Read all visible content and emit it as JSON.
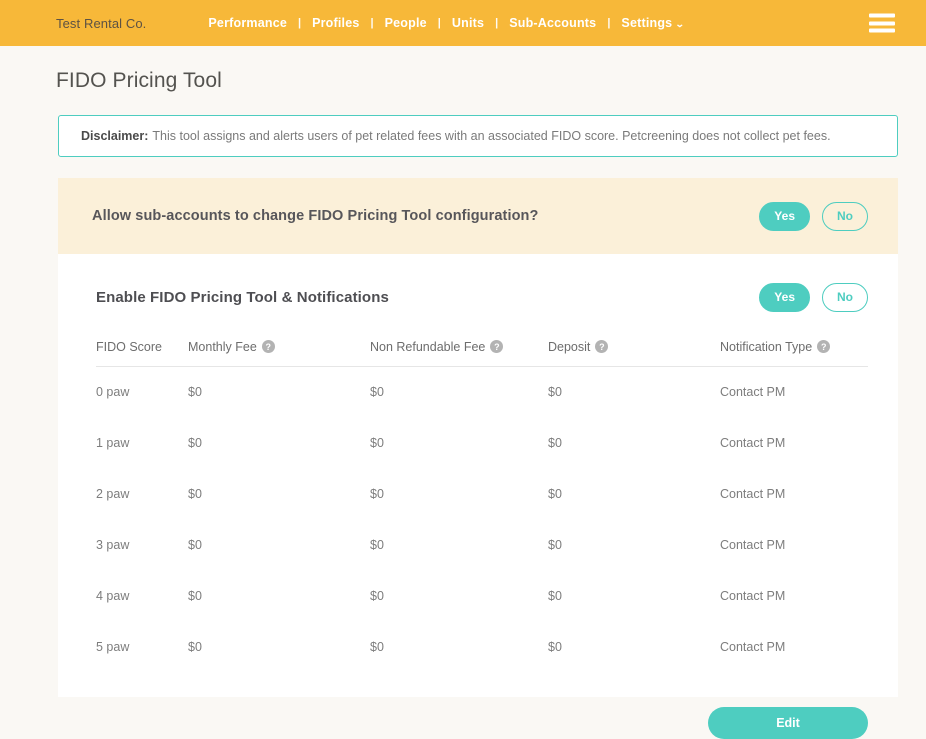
{
  "nav": {
    "brand": "Test Rental Co.",
    "separator": "|",
    "links": [
      {
        "label": "Performance",
        "has_caret": false
      },
      {
        "label": "Profiles",
        "has_caret": false
      },
      {
        "label": "People",
        "has_caret": false
      },
      {
        "label": "Units",
        "has_caret": false
      },
      {
        "label": "Sub-Accounts",
        "has_caret": false
      },
      {
        "label": "Settings",
        "has_caret": true
      }
    ],
    "caret_glyph": "⌄",
    "menu_icon": "hamburger-menu-icon",
    "background_color": "#f7b839"
  },
  "page": {
    "title": "FIDO Pricing Tool",
    "background_color": "#faf8f4"
  },
  "disclaimer": {
    "label": "Disclaimer:",
    "text": "This tool assigns and alerts users of pet related fees with an associated FIDO score. Petcreening does not collect pet fees.",
    "border_color": "#4ecdc0"
  },
  "sub_accounts": {
    "question": "Allow sub-accounts to change FIDO Pricing Tool configuration?",
    "yes_label": "Yes",
    "no_label": "No",
    "selected": "Yes",
    "background_color": "#fbf0d9"
  },
  "enable_section": {
    "title": "Enable FIDO Pricing Tool & Notifications",
    "yes_label": "Yes",
    "no_label": "No",
    "selected": "Yes"
  },
  "table": {
    "headers": [
      {
        "label": "FIDO Score",
        "help": false
      },
      {
        "label": "Monthly Fee",
        "help": true
      },
      {
        "label": "Non Refundable Fee",
        "help": true
      },
      {
        "label": "Deposit",
        "help": true
      },
      {
        "label": "Notification Type",
        "help": true
      }
    ],
    "help_glyph": "?",
    "rows": [
      {
        "score": "0 paw",
        "monthly_fee": "$0",
        "non_refundable_fee": "$0",
        "deposit": "$0",
        "notification_type": "Contact PM"
      },
      {
        "score": "1 paw",
        "monthly_fee": "$0",
        "non_refundable_fee": "$0",
        "deposit": "$0",
        "notification_type": "Contact PM"
      },
      {
        "score": "2 paw",
        "monthly_fee": "$0",
        "non_refundable_fee": "$0",
        "deposit": "$0",
        "notification_type": "Contact PM"
      },
      {
        "score": "3 paw",
        "monthly_fee": "$0",
        "non_refundable_fee": "$0",
        "deposit": "$0",
        "notification_type": "Contact PM"
      },
      {
        "score": "4 paw",
        "monthly_fee": "$0",
        "non_refundable_fee": "$0",
        "deposit": "$0",
        "notification_type": "Contact PM"
      },
      {
        "score": "5 paw",
        "monthly_fee": "$0",
        "non_refundable_fee": "$0",
        "deposit": "$0",
        "notification_type": "Contact PM"
      }
    ]
  },
  "actions": {
    "edit_label": "Edit",
    "accent_color": "#4ecdc0"
  }
}
